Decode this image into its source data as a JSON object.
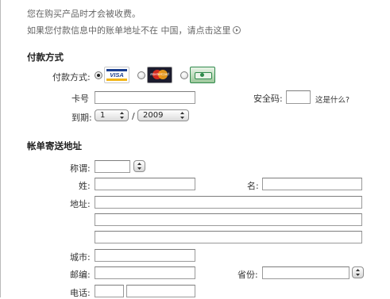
{
  "intro": {
    "line1": "您在购买产品时才会被收费。",
    "line2": "如果您付款信息中的账单地址不在 中国，请点击这里"
  },
  "payment": {
    "section_title": "付款方式",
    "method_label": "付款方式:",
    "cards": [
      {
        "name": "VISA",
        "selected": true
      },
      {
        "name": "MasterCard",
        "selected": false
      },
      {
        "name": "",
        "selected": false
      }
    ],
    "card_number_label": "卡号",
    "card_number_value": "",
    "security_code_label": "安全码:",
    "security_code_value": "",
    "whats_this": "这是什么?",
    "expiry_label": "到期:",
    "expiry_month": "1",
    "expiry_separator": "/",
    "expiry_year": "2009"
  },
  "billing": {
    "section_title": "帐单寄送地址",
    "salutation_label": "称谓:",
    "last_name_label": "姓:",
    "first_name_label": "名:",
    "address_label": "地址:",
    "city_label": "城市:",
    "postal_label": "邮编:",
    "province_label": "省份:",
    "phone_label": "电话:"
  },
  "colors": {
    "visa_blue": "#1a3e8f",
    "visa_gold": "#f2b417",
    "mc_red": "#d42a1e",
    "mc_orange": "#f6a21a",
    "third_card_green": "#2f8a4b"
  }
}
